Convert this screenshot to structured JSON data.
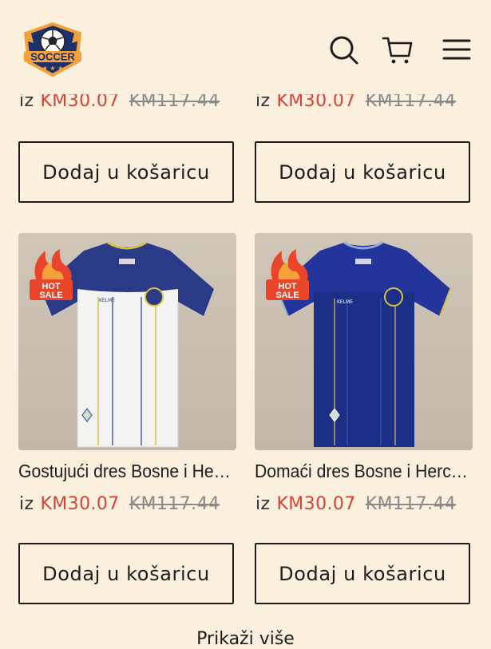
{
  "header": {
    "logo_text": "SOCCER",
    "icons": [
      "search-icon",
      "cart-icon",
      "menu-icon"
    ]
  },
  "colors": {
    "background": "#fbefdd",
    "sale_price": "#d2443a",
    "old_price": "#8a8a8a",
    "hot_sale": "#e8452a"
  },
  "top_row": [
    {
      "from": "iz",
      "price": "KM30.07",
      "old_price": "KM117.44",
      "button": "Dodaj u košaricu"
    },
    {
      "from": "iz",
      "price": "KM30.07",
      "old_price": "KM117.44",
      "button": "Dodaj u košaricu"
    }
  ],
  "products": [
    {
      "badge": "HOT SALE",
      "jersey_brand": "KELME",
      "title": "Gostujući dres Bosne i Hercegovine",
      "from": "iz",
      "price": "KM30.07",
      "old_price": "KM117.44",
      "button": "Dodaj u košaricu"
    },
    {
      "badge": "HOT SALE",
      "jersey_brand": "KELME",
      "title": "Domaći dres Bosne i Hercegovine",
      "from": "iz",
      "price": "KM30.07",
      "old_price": "KM117.44",
      "button": "Dodaj u košaricu"
    }
  ],
  "load_more": "Prikaži više"
}
